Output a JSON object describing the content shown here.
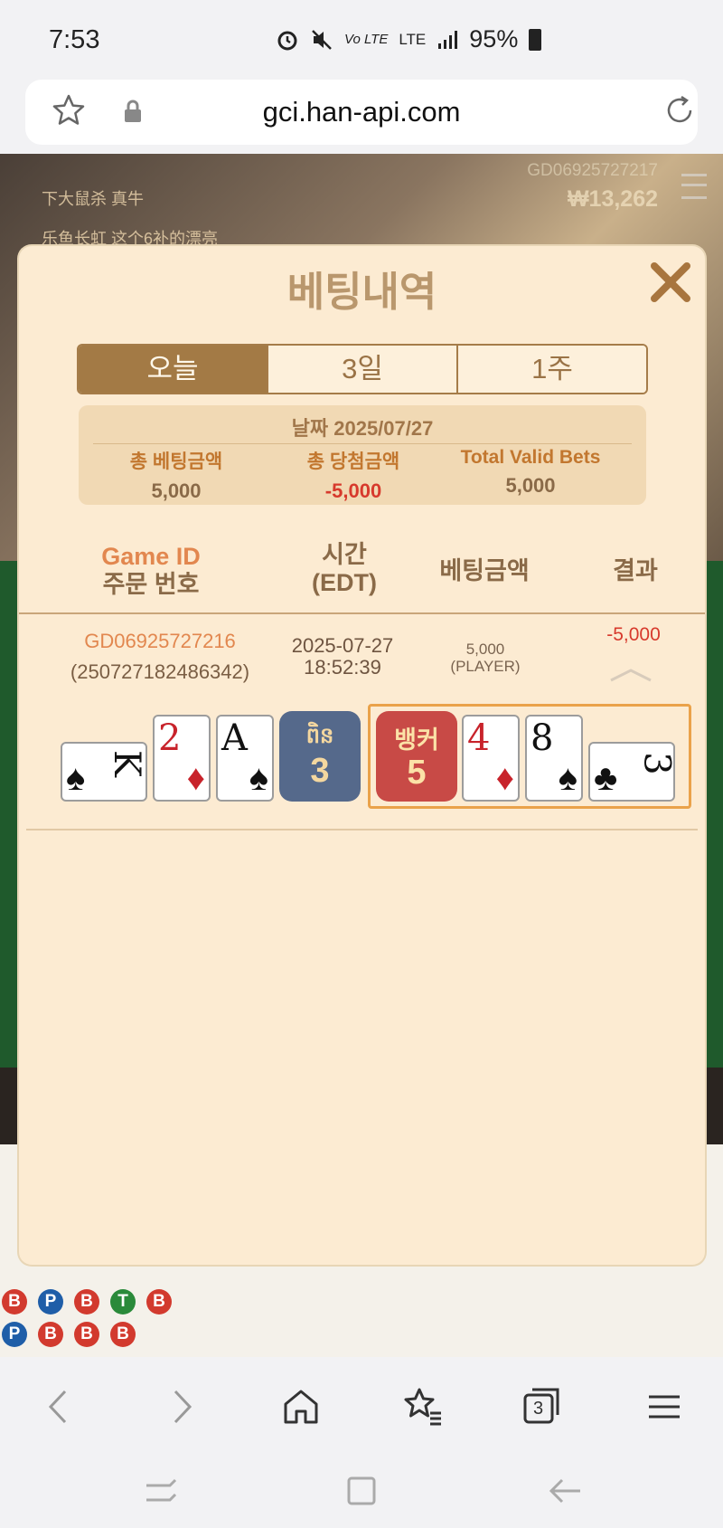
{
  "status_bar": {
    "time": "7:53",
    "indicators": "Vo LTE",
    "network": "LTE",
    "battery": "95%"
  },
  "browser": {
    "url": "gci.han-api.com",
    "tab_count": "3"
  },
  "background": {
    "chat": [
      "下大鼠杀 真牛",
      "乐鱼长虹 这个6补的漂亮"
    ],
    "game_id": "GD06925727217",
    "balance": "₩13,262"
  },
  "modal": {
    "title": "베팅내역",
    "tabs": [
      "오늘",
      "3일",
      "1주"
    ],
    "active_tab": 0,
    "summary": {
      "date_label": "날짜 2025/07/27",
      "total_bet_label": "총 베팅금액",
      "total_bet_value": "5,000",
      "total_win_label": "총 당첨금액",
      "total_win_value": "-5,000",
      "valid_label": "Total Valid Bets",
      "valid_value": "5,000"
    },
    "headers": {
      "game_id": "Game ID",
      "order_no": "주문 번호",
      "time": "시간",
      "time_zone": "(EDT)",
      "amount": "베팅금액",
      "result": "결과"
    },
    "row": {
      "game_id": "GD06925727216",
      "order_no": "(250727182486342)",
      "date": "2025-07-27",
      "time": "18:52:39",
      "amount": "5,000",
      "side": "(PLAYER)",
      "result": "-5,000"
    },
    "player": {
      "score_label": "ពិន",
      "score": "3",
      "cards": [
        {
          "rank": "K",
          "suit": "♠",
          "color": "black"
        },
        {
          "rank": "2",
          "suit": "♦",
          "color": "red"
        },
        {
          "rank": "A",
          "suit": "♠",
          "color": "black"
        }
      ]
    },
    "banker": {
      "score_label": "뱅커",
      "score": "5",
      "cards": [
        {
          "rank": "4",
          "suit": "♦",
          "color": "red"
        },
        {
          "rank": "8",
          "suit": "♠",
          "color": "black"
        },
        {
          "rank": "3",
          "suit": "♣",
          "color": "black"
        }
      ]
    }
  },
  "colors": {
    "modal_bg": "#fcebd2",
    "accent_brown": "#a37a45",
    "header_orange": "#e2874f",
    "negative_red": "#d7392c",
    "player_blue": "#55698b",
    "banker_red": "#c84a46",
    "banker_highlight": "#eaa24a"
  }
}
